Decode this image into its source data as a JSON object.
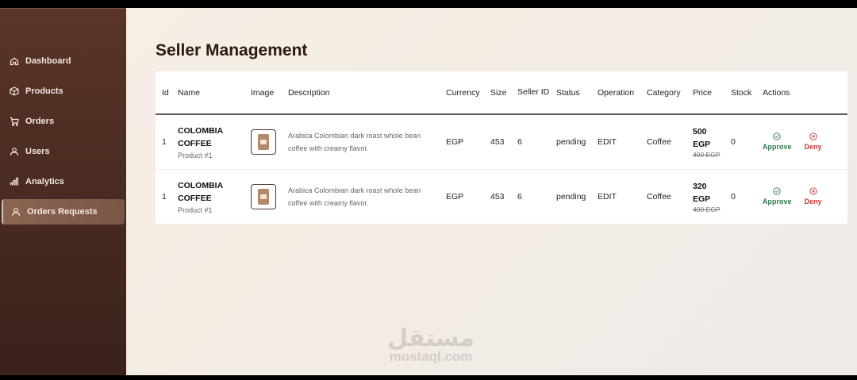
{
  "sidebar": {
    "items": [
      {
        "label": "Dashboard",
        "icon": "home-icon"
      },
      {
        "label": "Products",
        "icon": "box-icon"
      },
      {
        "label": "Orders",
        "icon": "cart-icon"
      },
      {
        "label": "Users",
        "icon": "user-icon"
      },
      {
        "label": "Analytics",
        "icon": "bar-chart-icon"
      },
      {
        "label": "Orders Requests",
        "icon": "user-icon",
        "active": true
      }
    ]
  },
  "main": {
    "title": "Seller Management",
    "table": {
      "headers": [
        "Id",
        "Name",
        "Image",
        "Description",
        "Currency",
        "Size",
        "Seller ID",
        "Status",
        "Operation",
        "Category",
        "Price",
        "Stock",
        "Actions"
      ],
      "rows": [
        {
          "id": "1",
          "name": "COLOMBIA COFFEE",
          "sub": "Product #1",
          "image": "coffee-bag-thumbnail",
          "description": "Arabica Colombian dark roast whole bean coffee with creamy flavor.",
          "currency": "EGP",
          "size": "453",
          "seller_id": "6",
          "status": "pending",
          "operation": "EDIT",
          "category": "Coffee",
          "price": "500 EGP",
          "old_price": "400 EGP",
          "stock": "0",
          "approve_label": "Approve",
          "deny_label": "Deny"
        },
        {
          "id": "1",
          "name": "COLOMBIA COFFEE",
          "sub": "Product #1",
          "image": "coffee-bag-thumbnail",
          "description": "Arabica Colombian dark roast whole bean coffee with creamy flavor.",
          "currency": "EGP",
          "size": "453",
          "seller_id": "6",
          "status": "pending",
          "operation": "EDIT",
          "category": "Coffee",
          "price": "320 EGP",
          "old_price": "400 EGP",
          "stock": "0",
          "approve_label": "Approve",
          "deny_label": "Deny"
        }
      ]
    }
  },
  "watermark": {
    "logo_text": "مستقل",
    "text": "mostaql.com"
  },
  "colors": {
    "sidebar_bg": "#4a2c22",
    "approve": "#2f7a4a",
    "deny": "#c23a3a"
  }
}
